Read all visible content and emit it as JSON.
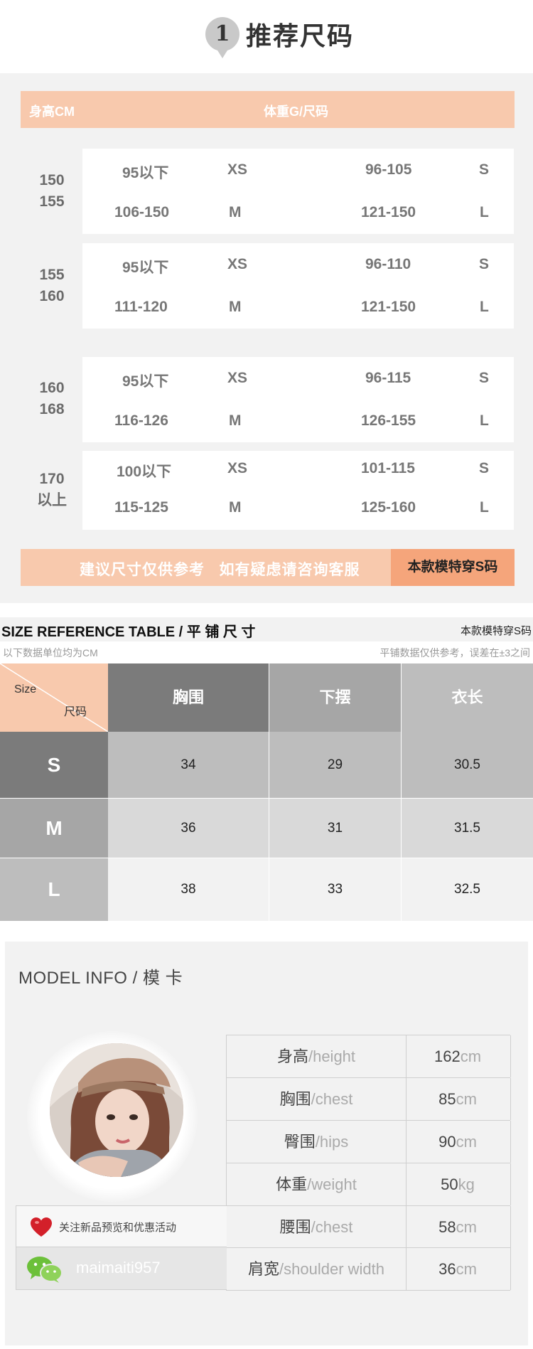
{
  "section1": {
    "badge_number": "1",
    "title": "推荐尺码",
    "header": {
      "left": "身高CM",
      "center": "体重G/尺码"
    },
    "groups": [
      {
        "height_lines": [
          "150",
          "155"
        ],
        "rows": [
          [
            "95以下",
            "XS",
            "96-105",
            "S"
          ],
          [
            "106-150",
            "M",
            "121-150",
            "L"
          ]
        ]
      },
      {
        "height_lines": [
          "155",
          "160"
        ],
        "rows": [
          [
            "95以下",
            "XS",
            "96-110",
            "S"
          ],
          [
            "111-120",
            "M",
            "121-150",
            "L"
          ]
        ]
      },
      {
        "height_lines": [
          "160",
          "168"
        ],
        "rows": [
          [
            "95以下",
            "XS",
            "96-115",
            "S"
          ],
          [
            "116-126",
            "M",
            "126-155",
            "L"
          ]
        ]
      },
      {
        "height_lines": [
          "170",
          "以上"
        ],
        "rows": [
          [
            "100以下",
            "XS",
            "101-115",
            "S"
          ],
          [
            "115-125",
            "M",
            "125-160",
            "L"
          ]
        ]
      }
    ],
    "footer": {
      "message": "建议尺寸仅供参考   如有疑虑请咨询客服",
      "model_size": "本款模特穿S码"
    }
  },
  "section2": {
    "title": "SIZE REFERENCE TABLE / 平 铺 尺 寸",
    "right_note": "本款模特穿S码",
    "sub_left": "以下数据单位均为CM",
    "sub_right": "平铺数据仅供参考，误差在±3之间",
    "corner_top": "Size",
    "corner_bottom": "尺码",
    "columns": [
      "胸围",
      "下摆",
      "衣长"
    ],
    "rows": [
      {
        "size": "S",
        "values": [
          "34",
          "29",
          "30.5"
        ]
      },
      {
        "size": "M",
        "values": [
          "36",
          "31",
          "31.5"
        ]
      },
      {
        "size": "L",
        "values": [
          "38",
          "33",
          "32.5"
        ]
      }
    ]
  },
  "section3": {
    "title": "MODEL INFO / 模 卡",
    "stats": [
      {
        "label_cn": "身高",
        "label_en": "/height",
        "value": "162",
        "unit": "cm"
      },
      {
        "label_cn": "胸围",
        "label_en": "/chest",
        "value": "85",
        "unit": "cm"
      },
      {
        "label_cn": "臀围",
        "label_en": "/hips",
        "value": "90",
        "unit": "cm"
      },
      {
        "label_cn": "体重",
        "label_en": "/weight",
        "value": "50",
        "unit": "kg"
      },
      {
        "label_cn": "腰围",
        "label_en": "/chest",
        "value": "58",
        "unit": "cm"
      },
      {
        "label_cn": "肩宽",
        "label_en": "/shoulder width",
        "value": "36",
        "unit": "cm"
      }
    ],
    "follow_text": "关注新品预览和优惠活动",
    "wechat_id": "maimaiti957",
    "icons": {
      "follow": "heart-icon",
      "wechat": "wechat-icon"
    }
  }
}
